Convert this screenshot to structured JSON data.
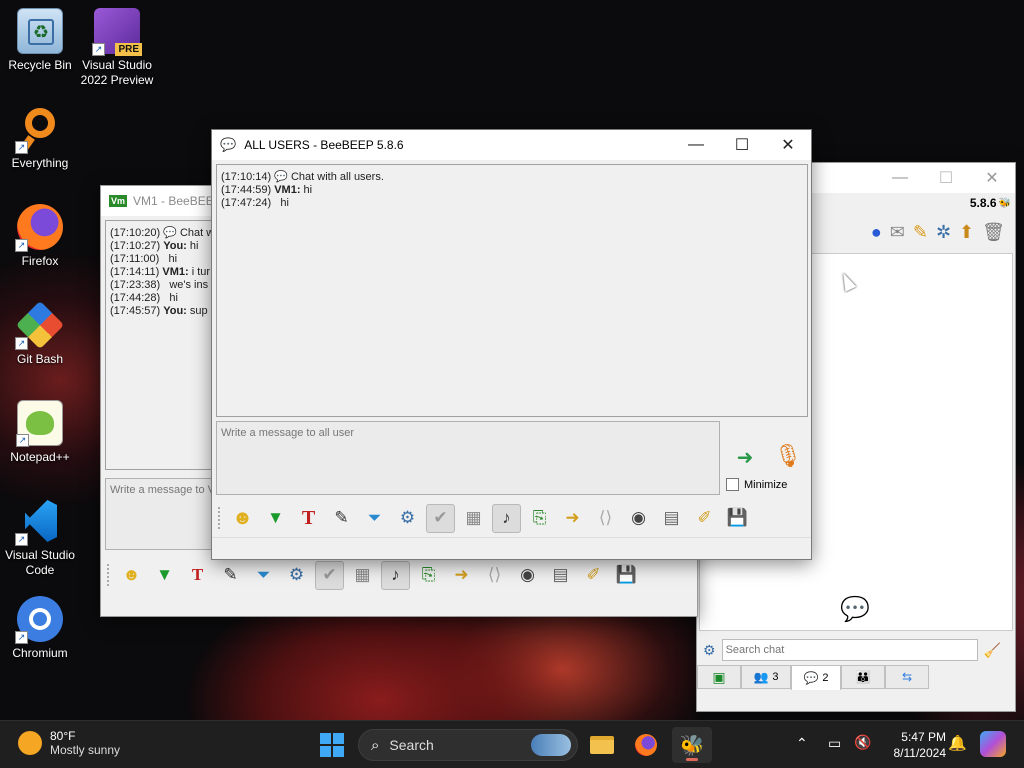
{
  "desktop": {
    "icons": [
      {
        "label": "Recycle Bin",
        "icon": "recycle-bin-icon"
      },
      {
        "label": "Visual Studio 2022 Preview",
        "icon": "visual-studio-preview-icon",
        "badge": "PRE"
      },
      {
        "label": "Everything",
        "icon": "everything-search-icon"
      },
      {
        "label": "Firefox",
        "icon": "firefox-icon"
      },
      {
        "label": "Git Bash",
        "icon": "git-bash-icon"
      },
      {
        "label": "Notepad++",
        "icon": "notepad-plus-plus-icon"
      },
      {
        "label": "Visual Studio Code",
        "icon": "vscode-icon"
      },
      {
        "label": "Chromium",
        "icon": "chromium-icon"
      }
    ]
  },
  "vm1_window": {
    "title": "VM1 - BeeBEEP",
    "app_badge": "Vm",
    "chat_lines": [
      {
        "time": "(17:10:20)",
        "sender": "",
        "text": "Chat w"
      },
      {
        "time": "(17:10:27)",
        "sender": "You:",
        "text": "hi"
      },
      {
        "time": "(17:11:00)",
        "sender": "",
        "text": "hi"
      },
      {
        "time": "(17:14:11)",
        "sender": "VM1:",
        "text": "i tur"
      },
      {
        "time": "(17:23:38)",
        "sender": "",
        "text": "we's ins"
      },
      {
        "time": "(17:44:28)",
        "sender": "",
        "text": "hi"
      },
      {
        "time": "(17:45:57)",
        "sender": "You:",
        "text": "sup"
      }
    ],
    "compose_placeholder": "Write a message to V"
  },
  "main_window": {
    "title": "ALL USERS - BeeBEEP 5.8.6",
    "controls": {
      "minimize": "—",
      "maximize": "☐",
      "close": "✕"
    },
    "chat_lines": [
      {
        "time": "(17:10:14)",
        "sender": "",
        "text": "Chat with all users."
      },
      {
        "time": "(17:44:59)",
        "sender": "VM1:",
        "text": "hi"
      },
      {
        "time": "(17:47:24)",
        "sender": "",
        "text": "hi"
      }
    ],
    "compose_placeholder": "Write a message to all user",
    "minimize_checkbox": {
      "label": "Minimize",
      "checked": false
    }
  },
  "right_window": {
    "version": "5.8.6",
    "search_placeholder": "Search chat",
    "tabs": [
      {
        "name": "tab-home",
        "label": "",
        "icon": "home-icon"
      },
      {
        "name": "tab-users",
        "label": "3",
        "icon": "users-icon"
      },
      {
        "name": "tab-chats",
        "label": "2",
        "icon": "chat-bubbles-icon"
      },
      {
        "name": "tab-groups",
        "label": "",
        "icon": "groups-icon"
      },
      {
        "name": "tab-files",
        "label": "",
        "icon": "file-share-icon"
      }
    ]
  },
  "taskbar": {
    "weather": {
      "temp": "80°F",
      "desc": "Mostly sunny"
    },
    "search_label": "Search",
    "clock": {
      "time": "5:47 PM",
      "date": "8/11/2024"
    }
  },
  "colors": {
    "title_active": "#000000",
    "title_inactive": "#8a8a8a",
    "taskbar": "#1f1f1f",
    "accent_blue": "#0078d4"
  }
}
